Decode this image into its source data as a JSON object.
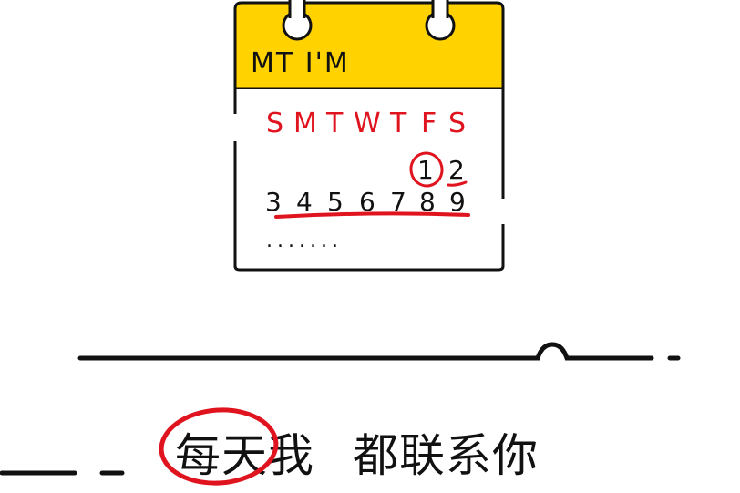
{
  "calendar": {
    "title": "MT I'M",
    "weekdays": [
      "S",
      "M",
      "T",
      "W",
      "T",
      "F",
      "S"
    ],
    "week1": [
      "1",
      "2"
    ],
    "week2": [
      "3",
      "4",
      "5",
      "6",
      "7",
      "8",
      "9"
    ],
    "more": ".......",
    "accent_yellow": "#ffd200",
    "accent_red": "#e0141e"
  },
  "slogan": {
    "part1": "每天我",
    "part2": "都联系你"
  }
}
